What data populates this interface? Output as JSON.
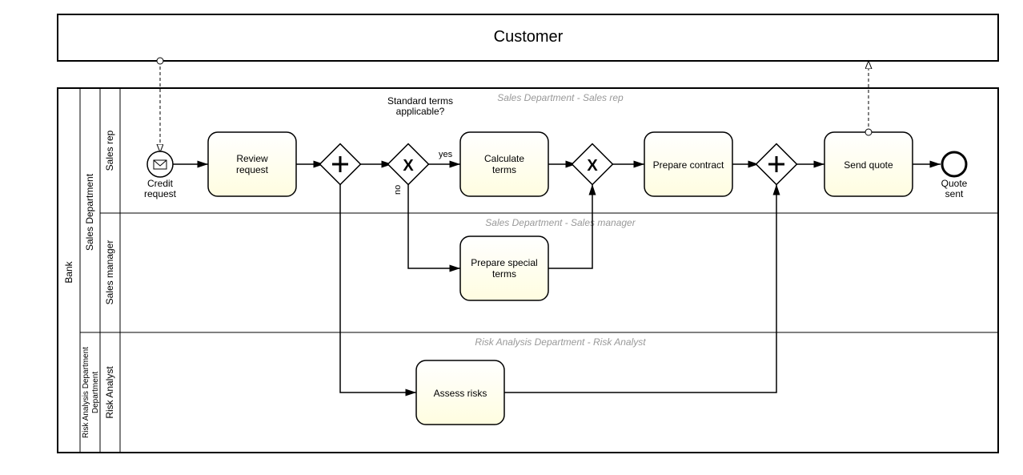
{
  "pools": {
    "customer": {
      "label": "Customer"
    },
    "bank": {
      "label": "Bank"
    }
  },
  "lanes": {
    "sales_department": {
      "label": "Sales Department",
      "sublanes": {
        "sales_rep": {
          "label": "Sales rep",
          "caption": "Sales Department - Sales rep"
        },
        "sales_manager": {
          "label": "Sales manager",
          "caption": "Sales Department - Sales manager"
        }
      }
    },
    "risk_analysis": {
      "label": "Risk Analysis Department",
      "sublanes": {
        "risk_analyst": {
          "label": "Risk Analyst",
          "caption": "Risk Analysis Department - Risk Analyst"
        }
      }
    }
  },
  "events": {
    "start": {
      "label": "Credit request"
    },
    "end": {
      "label": "Quote sent"
    }
  },
  "tasks": {
    "review_request": {
      "label": "Review request"
    },
    "calculate_terms": {
      "label": "Calculate terms"
    },
    "prepare_contract": {
      "label": "Prepare contract"
    },
    "send_quote": {
      "label": "Send quote"
    },
    "prepare_special_terms": {
      "label": "Prepare special terms"
    },
    "assess_risks": {
      "label": "Assess risks"
    }
  },
  "gateways": {
    "parallel_split": {
      "type": "parallel"
    },
    "exclusive_split": {
      "type": "exclusive",
      "label": "Standard terms applicable?"
    },
    "exclusive_join": {
      "type": "exclusive"
    },
    "parallel_join": {
      "type": "parallel"
    }
  },
  "flows": {
    "yes": "yes",
    "no": "no"
  }
}
